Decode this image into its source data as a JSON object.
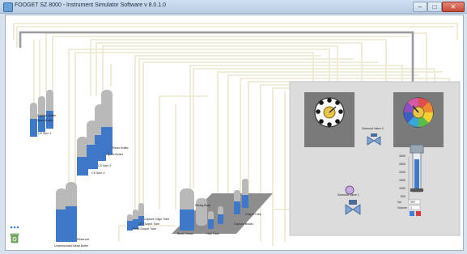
{
  "window": {
    "title": "FOOGET SZ 8000 - Instrument Simulator Software v 8.0.1.0",
    "minimize_glyph": "–",
    "maximize_glyph": "□",
    "close_glyph": "✕"
  },
  "colors": {
    "liquid": "#3f78c8",
    "empty": "#b9b9b9",
    "tubing": "#ece8cf",
    "panel": "#dcdcdc",
    "valve_block": "#7a7a7a"
  },
  "bottles": {
    "wash_buffer": "Wash Buffer",
    "capture_buffer": "Capture Buffer",
    "hybrid_buffer": "Hybrid Buffer",
    "cs_sem1": "CS Sem 1",
    "rinse_buffer": "Rinse Buffer",
    "cs_sem2": "CS Sem 2",
    "cs_sem3": "CS Sem 3",
    "reservoir": "Reservoir",
    "unannounced_bead": "Unannounced Bead Bottle",
    "capture_oligo": "Capture Oligo Tube",
    "qc_output": "QC Output Tube",
    "bead_output": "Bead Output Tube",
    "bead_vessel": "Bead Vessel",
    "mixing_bowl": "Mixing Bowl",
    "hub_tube": "Hub Tube",
    "output_tube": "Output Tube",
    "capture_beads": "Capture Beads"
  },
  "valves": {
    "solenoid2": "Solenoid Valve 2",
    "solenoid1": "Solenoid Valve 1"
  },
  "pump": {
    "value1": "997",
    "value2": "1",
    "label1": "Vol",
    "label2": "Volume",
    "scale": [
      "500",
      "1000",
      "1500",
      "2000",
      "2500",
      "3000"
    ]
  }
}
